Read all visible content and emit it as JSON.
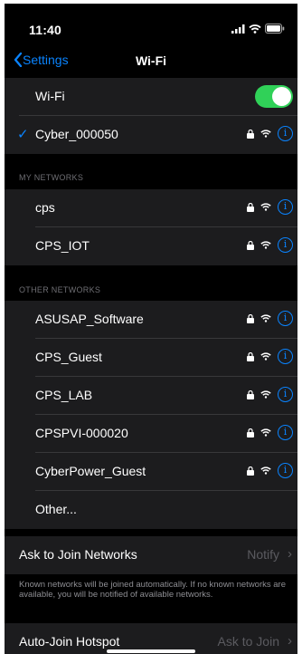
{
  "status_bar": {
    "time": "11:40"
  },
  "nav": {
    "back_label": "Settings",
    "title": "Wi-Fi"
  },
  "wifi": {
    "label": "Wi-Fi",
    "enabled": true,
    "connected_network": "Cyber_000050"
  },
  "my_networks": {
    "header": "MY NETWORKS",
    "items": [
      {
        "name": "cps",
        "secured": true
      },
      {
        "name": "CPS_IOT",
        "secured": true
      }
    ]
  },
  "other_networks": {
    "header": "OTHER NETWORKS",
    "items": [
      {
        "name": "ASUSAP_Software",
        "secured": true
      },
      {
        "name": "CPS_Guest",
        "secured": true
      },
      {
        "name": "CPS_LAB",
        "secured": true
      },
      {
        "name": "CPSPVI-000020",
        "secured": true
      },
      {
        "name": "CyberPower_Guest",
        "secured": true
      }
    ],
    "other_label": "Other..."
  },
  "ask_to_join": {
    "label": "Ask to Join Networks",
    "value": "Notify",
    "footnote": "Known networks will be joined automatically. If no known networks are available, you will be notified of available networks."
  },
  "auto_join": {
    "label": "Auto-Join Hotspot",
    "value": "Ask to Join"
  },
  "colors": {
    "accent": "#0a84ff",
    "toggle_on": "#30d158",
    "background": "#000000",
    "cell": "#1c1c1e"
  }
}
